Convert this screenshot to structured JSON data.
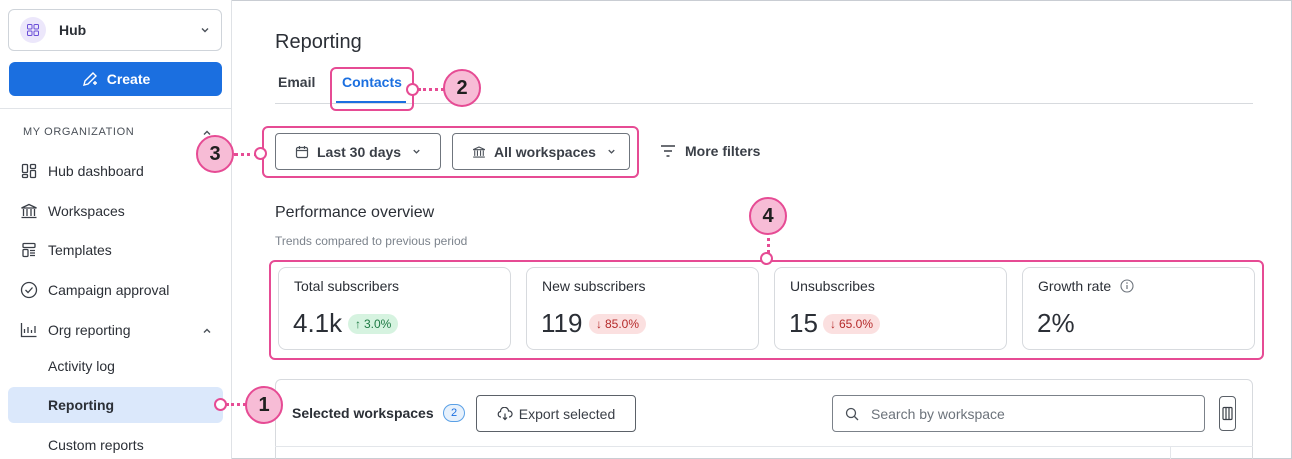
{
  "sidebar": {
    "hub_label": "Hub",
    "create_label": "Create",
    "section_label": "MY ORGANIZATION",
    "items": [
      {
        "label": "Hub dashboard",
        "icon": "dashboard-icon"
      },
      {
        "label": "Workspaces",
        "icon": "building-icon"
      },
      {
        "label": "Templates",
        "icon": "template-icon"
      },
      {
        "label": "Campaign approval",
        "icon": "check-circle-icon"
      },
      {
        "label": "Org reporting",
        "icon": "chart-icon"
      },
      {
        "label": "Activity log"
      },
      {
        "label": "Reporting",
        "active": true
      },
      {
        "label": "Custom reports"
      }
    ]
  },
  "header": {
    "title": "Reporting",
    "tabs": [
      {
        "label": "Email",
        "active": false
      },
      {
        "label": "Contacts",
        "active": true
      }
    ]
  },
  "filters": {
    "date_range": "Last 30 days",
    "workspaces": "All workspaces",
    "more_filters": "More filters"
  },
  "performance": {
    "title": "Performance overview",
    "subtitle": "Trends compared to previous period",
    "cards": [
      {
        "label": "Total subscribers",
        "value": "4.1k",
        "trend": "3.0%",
        "direction": "up"
      },
      {
        "label": "New subscribers",
        "value": "119",
        "trend": "85.0%",
        "direction": "down"
      },
      {
        "label": "Unsubscribes",
        "value": "15",
        "trend": "65.0%",
        "direction": "down"
      },
      {
        "label": "Growth rate",
        "value": "2%",
        "info_icon": "info-icon"
      }
    ]
  },
  "table": {
    "selected_label": "Selected workspaces",
    "selected_count": "2",
    "export_label": "Export selected",
    "search_placeholder": "Search by workspace"
  },
  "callouts": [
    "1",
    "2",
    "3",
    "4"
  ],
  "colors": {
    "accent": "#1b6fe0",
    "callout": "#e64b94",
    "callout_fill": "#f7bcd6",
    "active_nav": "#dbe8fb"
  }
}
